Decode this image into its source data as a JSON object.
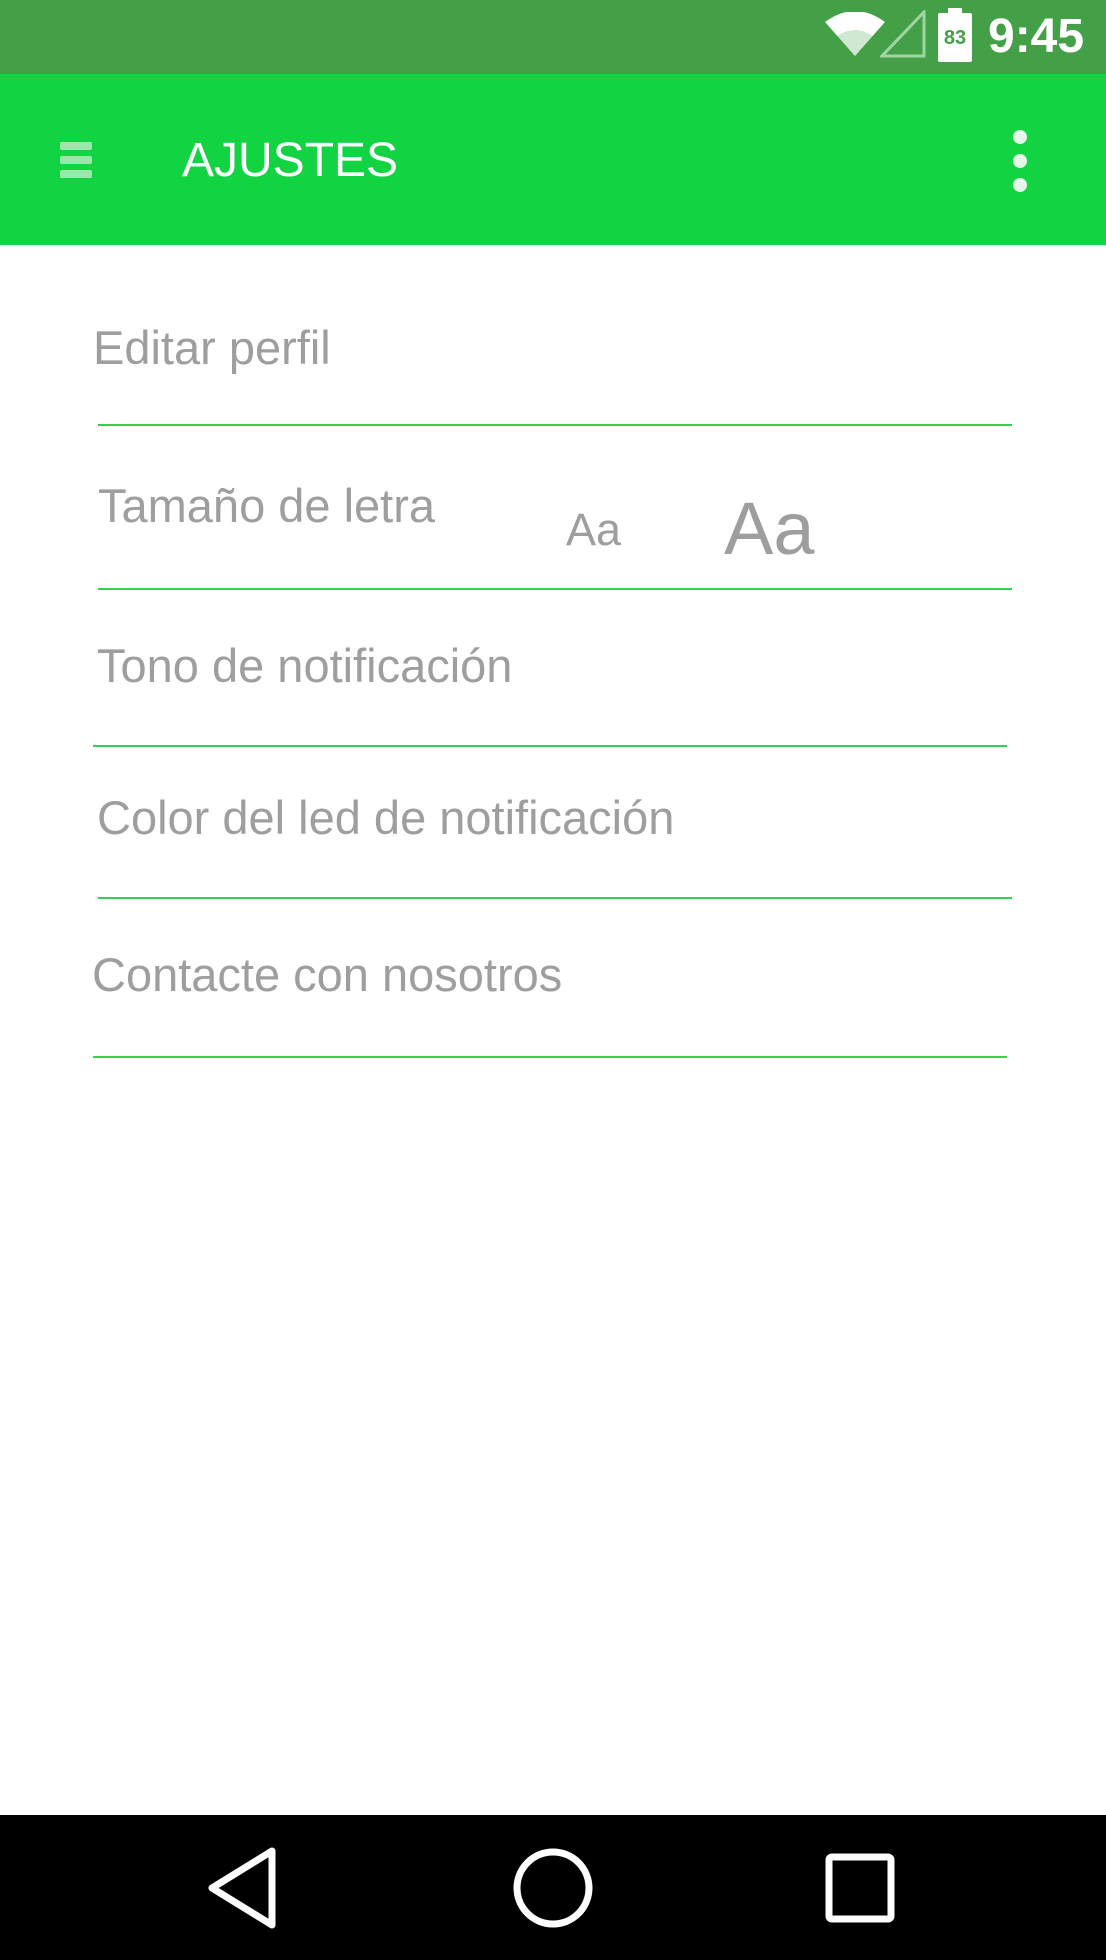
{
  "status_bar": {
    "time": "9:45",
    "battery_level": "83",
    "icons": [
      "wifi-icon",
      "cell-signal-icon",
      "battery-icon"
    ],
    "background_color": "#43a047"
  },
  "app_bar": {
    "title": "AJUSTES",
    "menu_icon": "hamburger-menu-icon",
    "overflow_icon": "more-vert-icon",
    "background_color": "#12d443"
  },
  "settings": {
    "edit_profile": "Editar perfil",
    "font_size": {
      "label": "Tamaño de letra",
      "small_option": "Aa",
      "large_option": "Aa"
    },
    "notification_tone": "Tono de notificación",
    "notification_led_color": "Color del led de notificación",
    "contact_us": "Contacte con nosotros",
    "divider_color": "#2fd351",
    "text_color": "#9e9e9e"
  },
  "nav_bar": {
    "back": "back-icon",
    "home": "home-icon",
    "recents": "recents-icon"
  }
}
